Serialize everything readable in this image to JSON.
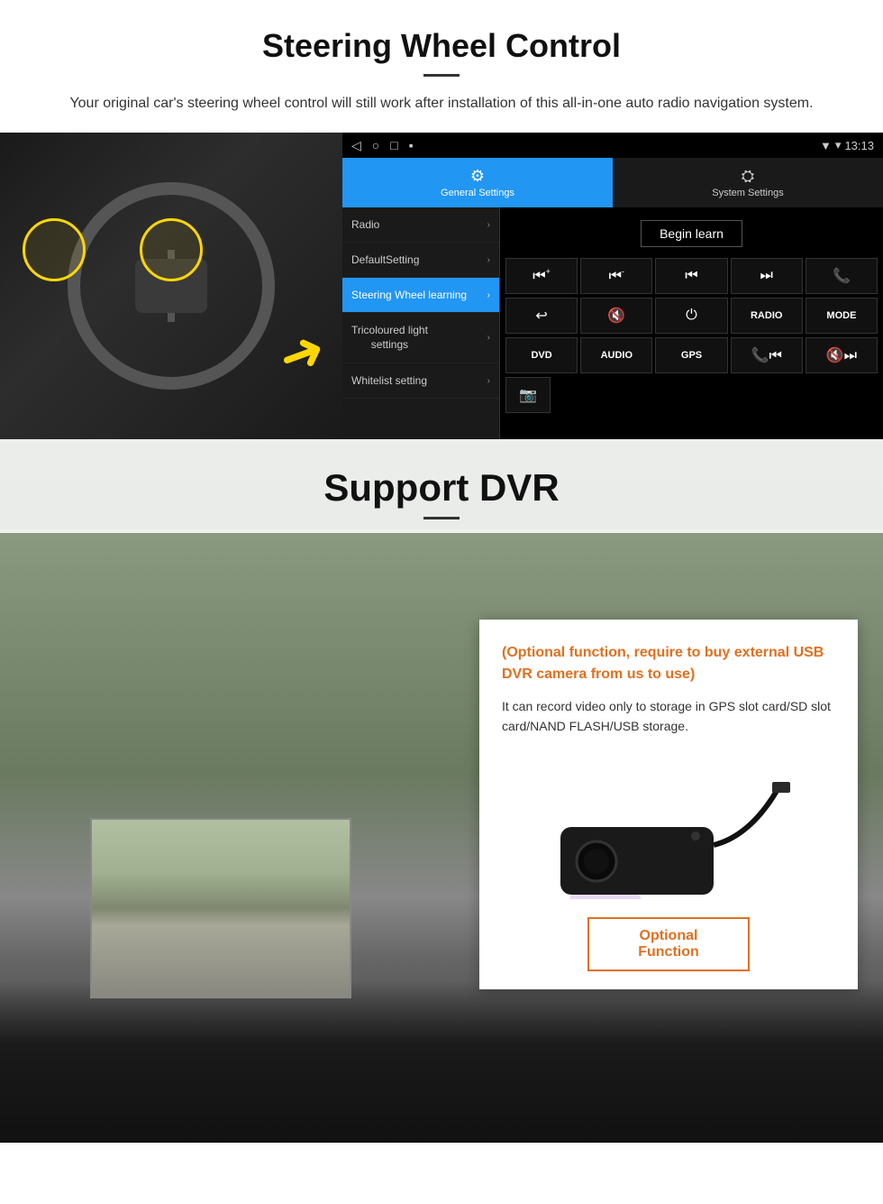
{
  "steering_section": {
    "title": "Steering Wheel Control",
    "description": "Your original car's steering wheel control will still work after installation of this all-in-one auto radio navigation system.",
    "status_bar": {
      "back": "◁",
      "home": "○",
      "square": "□",
      "menu": "▪",
      "signal": "▼",
      "wifi": "▾",
      "time": "13:13"
    },
    "tabs": {
      "general_settings": "General Settings",
      "system_settings": "System Settings",
      "general_icon": "⚙",
      "system_icon": "🔄"
    },
    "menu": {
      "items": [
        {
          "label": "Radio",
          "active": false
        },
        {
          "label": "DefaultSetting",
          "active": false
        },
        {
          "label": "Steering Wheel learning",
          "active": true
        },
        {
          "label": "Tricoloured light settings",
          "active": false
        },
        {
          "label": "Whitelist setting",
          "active": false
        }
      ]
    },
    "begin_learn": "Begin learn",
    "control_buttons": {
      "row1": [
        "⏮+",
        "⏮-",
        "⏮",
        "⏭",
        "📞"
      ],
      "row2": [
        "↩",
        "🔇",
        "⏻",
        "RADIO",
        "MODE"
      ],
      "row3": [
        "DVD",
        "AUDIO",
        "GPS",
        "📞⏮",
        "🔇⏭"
      ],
      "row4": [
        "📷"
      ]
    }
  },
  "dvr_section": {
    "title": "Support DVR",
    "optional_text": "(Optional function, require to buy external USB DVR camera from us to use)",
    "body_text": "It can record video only to storage in GPS slot card/SD slot card/NAND FLASH/USB storage.",
    "optional_function_btn": "Optional Function"
  }
}
